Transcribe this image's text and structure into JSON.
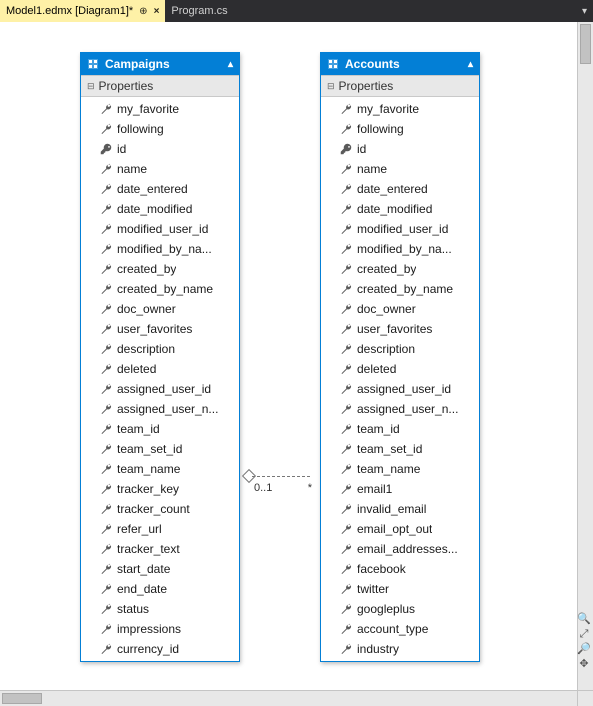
{
  "tabs": {
    "active": "Model1.edmx [Diagram1]*",
    "inactive": "Program.cs"
  },
  "relationship": {
    "left": "0..1",
    "right": "*"
  },
  "entities": {
    "campaigns": {
      "title": "Campaigns",
      "section": "Properties",
      "props": [
        {
          "k": "w",
          "t": "my_favorite"
        },
        {
          "k": "w",
          "t": "following"
        },
        {
          "k": "k",
          "t": "id"
        },
        {
          "k": "w",
          "t": "name"
        },
        {
          "k": "w",
          "t": "date_entered"
        },
        {
          "k": "w",
          "t": "date_modified"
        },
        {
          "k": "w",
          "t": "modified_user_id"
        },
        {
          "k": "w",
          "t": "modified_by_na..."
        },
        {
          "k": "w",
          "t": "created_by"
        },
        {
          "k": "w",
          "t": "created_by_name"
        },
        {
          "k": "w",
          "t": "doc_owner"
        },
        {
          "k": "w",
          "t": "user_favorites"
        },
        {
          "k": "w",
          "t": "description"
        },
        {
          "k": "w",
          "t": "deleted"
        },
        {
          "k": "w",
          "t": "assigned_user_id"
        },
        {
          "k": "w",
          "t": "assigned_user_n..."
        },
        {
          "k": "w",
          "t": "team_id"
        },
        {
          "k": "w",
          "t": "team_set_id"
        },
        {
          "k": "w",
          "t": "team_name"
        },
        {
          "k": "w",
          "t": "tracker_key"
        },
        {
          "k": "w",
          "t": "tracker_count"
        },
        {
          "k": "w",
          "t": "refer_url"
        },
        {
          "k": "w",
          "t": "tracker_text"
        },
        {
          "k": "w",
          "t": "start_date"
        },
        {
          "k": "w",
          "t": "end_date"
        },
        {
          "k": "w",
          "t": "status"
        },
        {
          "k": "w",
          "t": "impressions"
        },
        {
          "k": "w",
          "t": "currency_id"
        }
      ]
    },
    "accounts": {
      "title": "Accounts",
      "section": "Properties",
      "props": [
        {
          "k": "w",
          "t": "my_favorite"
        },
        {
          "k": "w",
          "t": "following"
        },
        {
          "k": "k",
          "t": "id"
        },
        {
          "k": "w",
          "t": "name"
        },
        {
          "k": "w",
          "t": "date_entered"
        },
        {
          "k": "w",
          "t": "date_modified"
        },
        {
          "k": "w",
          "t": "modified_user_id"
        },
        {
          "k": "w",
          "t": "modified_by_na..."
        },
        {
          "k": "w",
          "t": "created_by"
        },
        {
          "k": "w",
          "t": "created_by_name"
        },
        {
          "k": "w",
          "t": "doc_owner"
        },
        {
          "k": "w",
          "t": "user_favorites"
        },
        {
          "k": "w",
          "t": "description"
        },
        {
          "k": "w",
          "t": "deleted"
        },
        {
          "k": "w",
          "t": "assigned_user_id"
        },
        {
          "k": "w",
          "t": "assigned_user_n..."
        },
        {
          "k": "w",
          "t": "team_id"
        },
        {
          "k": "w",
          "t": "team_set_id"
        },
        {
          "k": "w",
          "t": "team_name"
        },
        {
          "k": "w",
          "t": "email1"
        },
        {
          "k": "w",
          "t": "invalid_email"
        },
        {
          "k": "w",
          "t": "email_opt_out"
        },
        {
          "k": "w",
          "t": "email_addresses..."
        },
        {
          "k": "w",
          "t": "facebook"
        },
        {
          "k": "w",
          "t": "twitter"
        },
        {
          "k": "w",
          "t": "googleplus"
        },
        {
          "k": "w",
          "t": "account_type"
        },
        {
          "k": "w",
          "t": "industry"
        }
      ]
    }
  }
}
